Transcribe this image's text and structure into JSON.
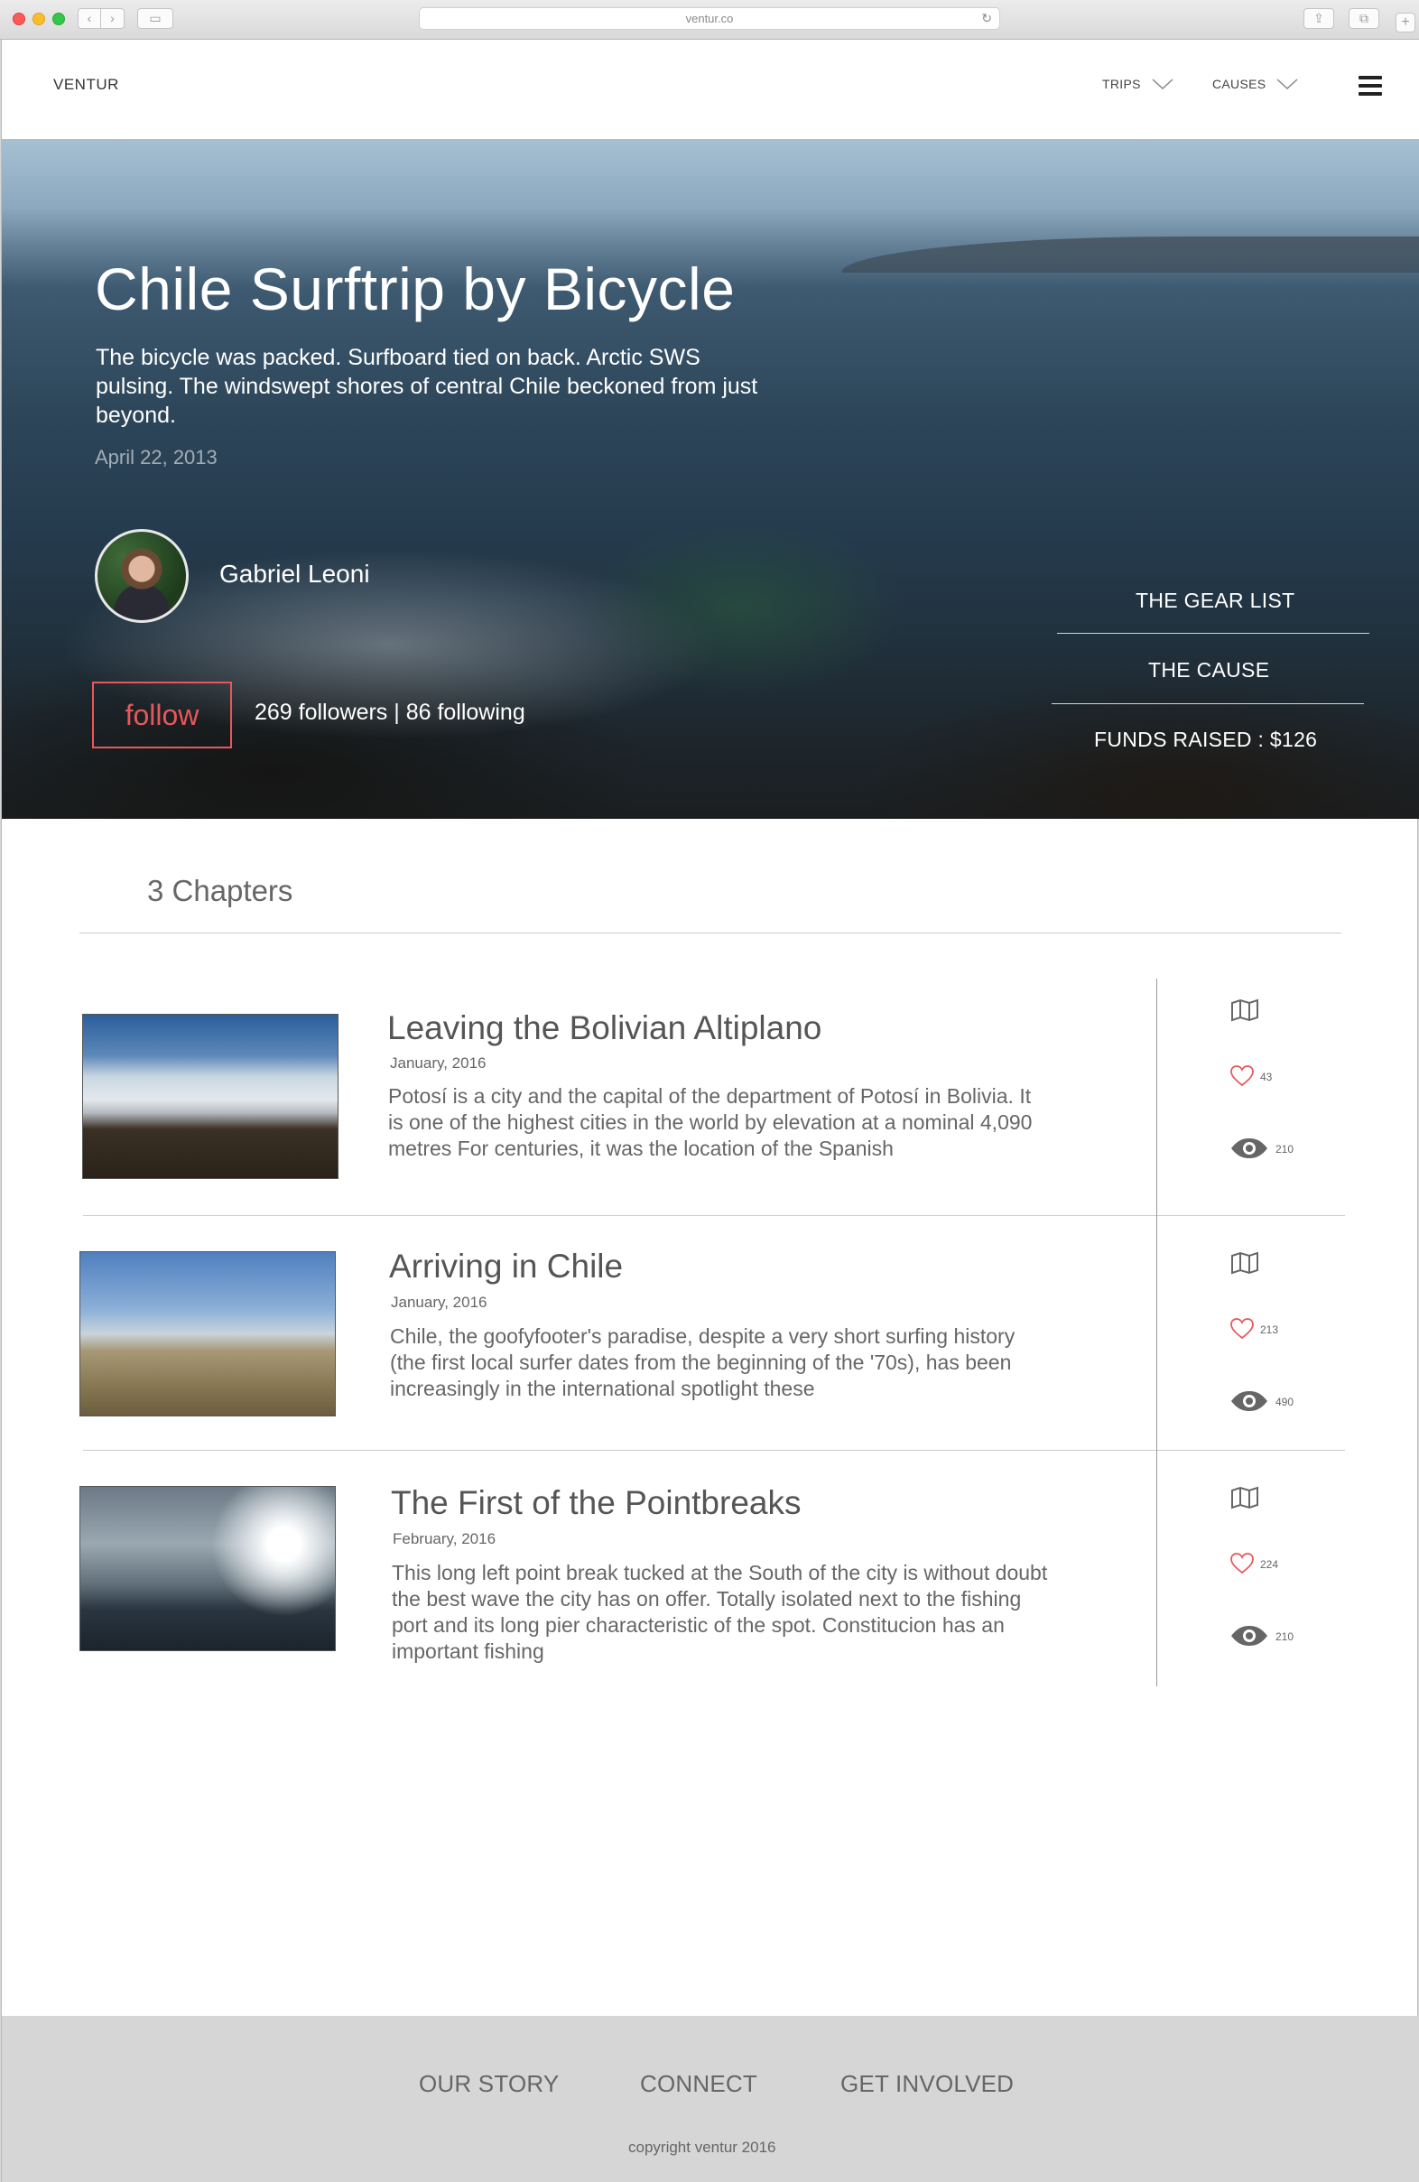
{
  "browser": {
    "url": "ventur.co"
  },
  "nav": {
    "brand": "VENTUR",
    "trips": "TRIPS",
    "causes": "CAUSES"
  },
  "hero": {
    "title": "Chile Surftrip by Bicycle",
    "description": "The bicycle was packed. Surfboard tied on back. Arctic SWS pulsing. The windswept shores of central Chile beckoned from just beyond.",
    "date": "April 22, 2013",
    "author": "Gabriel Leoni",
    "follow_label": "follow",
    "stats": "269 followers | 86 following",
    "gear_list": "THE GEAR LIST",
    "cause": "THE CAUSE",
    "funds": "FUNDS RAISED : $126"
  },
  "chapters_heading": "3 Chapters",
  "chapters": [
    {
      "title": "Leaving the Bolivian Altiplano",
      "date": "January, 2016",
      "excerpt": "Potosí is a city and the capital of the department of Potosí in Bolivia. It is one of the highest cities in the world by elevation at a nominal 4,090 metres For centuries, it was the location of the Spanish",
      "likes": "43",
      "views": "210"
    },
    {
      "title": "Arriving in Chile",
      "date": "January, 2016",
      "excerpt": "Chile, the goofyfooter's paradise, despite a very short surfing history (the first local surfer dates from the beginning of the '70s), has been increasingly in the international spotlight these",
      "likes": "213",
      "views": "490"
    },
    {
      "title": "The First of the Pointbreaks",
      "date": "February, 2016",
      "excerpt": "This long left point break tucked at the South of the city is without doubt the best wave the city has on offer. Totally isolated next to the fishing port and its long pier characteristic of the spot. Constitucion has an important fishing",
      "likes": "224",
      "views": "210"
    }
  ],
  "footer": {
    "our_story": "OUR STORY",
    "connect": "CONNECT",
    "get_involved": "GET INVOLVED",
    "copyright": "copyright ventur 2016"
  },
  "colors": {
    "accent": "#e8575a",
    "footer_bg": "#d6d6d6"
  }
}
